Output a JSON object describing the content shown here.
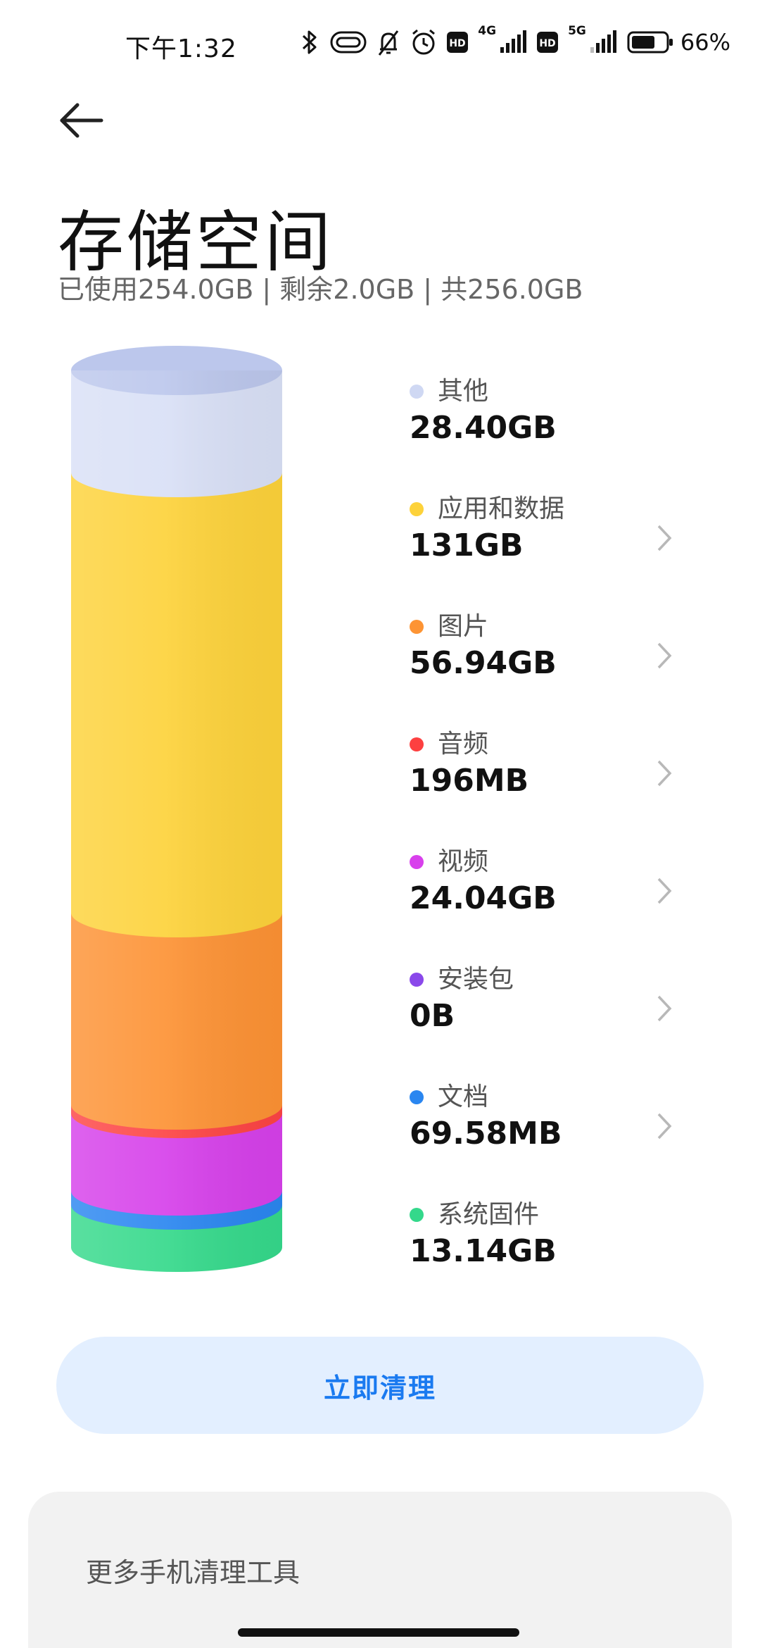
{
  "status_bar": {
    "time": "下午1:32",
    "net1": "4G",
    "net2": "5G",
    "hd": "HD",
    "battery": "66%"
  },
  "header": {
    "title": "存储空间",
    "summary": "已使用254.0GB | 剩余2.0GB | 共256.0GB"
  },
  "categories": [
    {
      "label": "其他",
      "value": "28.40GB",
      "color": "#cfd8f3",
      "chevron": false
    },
    {
      "label": "应用和数据",
      "value": "131GB",
      "color": "#fdd23a",
      "chevron": true
    },
    {
      "label": "图片",
      "value": "56.94GB",
      "color": "#fd9434",
      "chevron": true
    },
    {
      "label": "音频",
      "value": "196MB",
      "color": "#fd4040",
      "chevron": true
    },
    {
      "label": "视频",
      "value": "24.04GB",
      "color": "#d840ec",
      "chevron": true
    },
    {
      "label": "安装包",
      "value": "0B",
      "color": "#8a48ea",
      "chevron": true
    },
    {
      "label": "文档",
      "value": "69.58MB",
      "color": "#2a86f0",
      "chevron": true
    },
    {
      "label": "系统固件",
      "value": "13.14GB",
      "color": "#34d88b",
      "chevron": false
    }
  ],
  "actions": {
    "clean_label": "立即清理"
  },
  "more_tools": {
    "title": "更多手机清理工具"
  }
}
